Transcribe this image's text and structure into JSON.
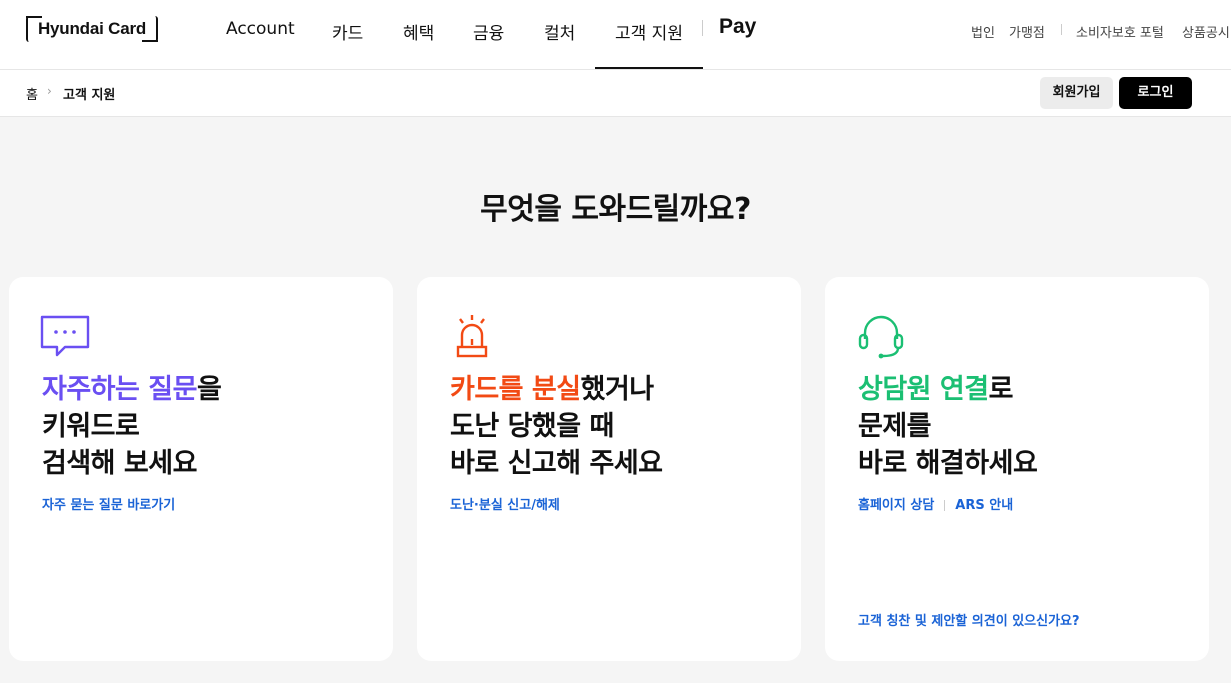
{
  "header": {
    "logo": "Hyundai Card",
    "nav": [
      {
        "label": "Account"
      },
      {
        "label": "카드"
      },
      {
        "label": "혜택"
      },
      {
        "label": "금융"
      },
      {
        "label": "컬처"
      },
      {
        "label": "고객 지원"
      }
    ],
    "applepay": "Pay",
    "util": [
      "법인",
      "가맹점",
      "소비자보호 포털",
      "상품공시"
    ]
  },
  "subbar": {
    "breadcrumb_home": "홈",
    "breadcrumb_sep": "›",
    "breadcrumb_current": "고객 지원",
    "join_label": "회원가입",
    "login_label": "로그인"
  },
  "main": {
    "headline": "무엇을 도와드릴까요?",
    "cards": [
      {
        "accent": "#6a4ff2",
        "icon": "chat-bubble-icon",
        "title_highlight": "자주하는 질문",
        "title_rest": "을",
        "title_line2": "키워드로",
        "title_line3": "검색해 보세요",
        "links": [
          "자주 묻는 질문 바로가기"
        ]
      },
      {
        "accent": "#f24a14",
        "icon": "siren-icon",
        "title_highlight": "카드를 분실",
        "title_rest": "했거나",
        "title_line2": "도난 당했을 때",
        "title_line3": "바로 신고해 주세요",
        "links": [
          "도난·분실 신고/해제"
        ]
      },
      {
        "accent": "#1bbf73",
        "icon": "headset-icon",
        "title_highlight": "상담원 연결",
        "title_rest": "로",
        "title_line2": "문제를",
        "title_line3": "바로 해결하세요",
        "links": [
          "홈페이지 상담",
          "ARS 안내"
        ],
        "bottom_link": "고객 칭찬 및 제안할 의견이 있으신가요?"
      }
    ]
  },
  "colors": {
    "link": "#1a63d6",
    "background": "#f5f5f5"
  }
}
